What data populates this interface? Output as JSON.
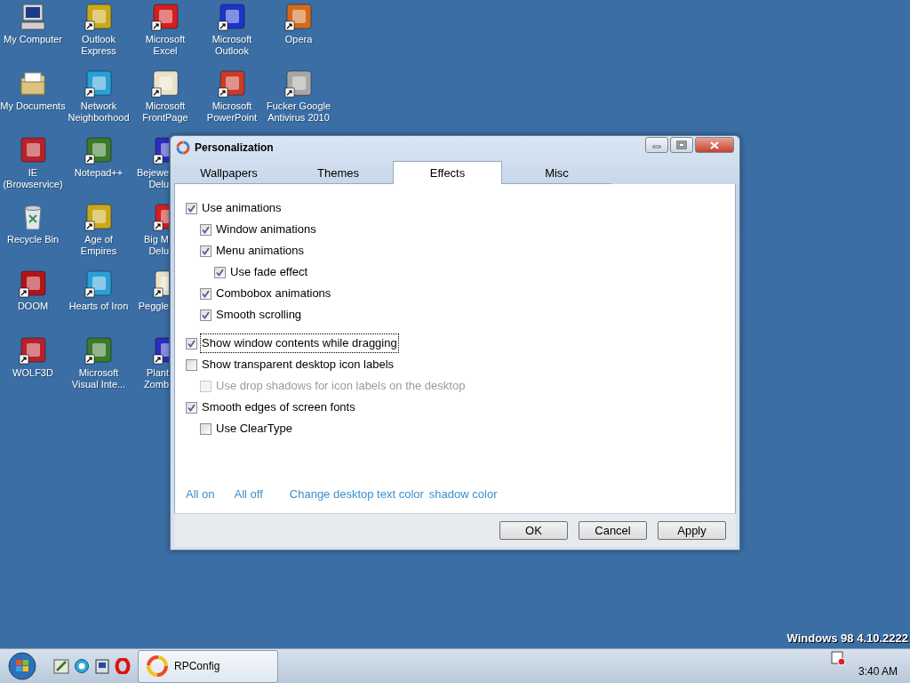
{
  "desktop_rows": [
    [
      {
        "label": [
          "My Computer"
        ]
      },
      {
        "label": [
          "Outlook",
          "Express"
        ]
      },
      {
        "label": [
          "Microsoft",
          "Excel"
        ]
      },
      {
        "label": [
          "Microsoft",
          "Outlook"
        ]
      },
      {
        "label": [
          "Opera"
        ]
      }
    ],
    [
      {
        "label": [
          "My Documents"
        ]
      },
      {
        "label": [
          "Network",
          "Neighborhood"
        ]
      },
      {
        "label": [
          "Microsoft",
          "FrontPage"
        ]
      },
      {
        "label": [
          "Microsoft",
          "PowerPoint"
        ]
      },
      {
        "label": [
          "Fucker Google",
          "Antivirus 2010"
        ]
      }
    ],
    [
      {
        "label": [
          "IE",
          "(Browservice)"
        ]
      },
      {
        "label": [
          "Notepad++"
        ]
      },
      {
        "label": [
          "Bejewe",
          "Delu"
        ]
      }
    ],
    [
      {
        "label": [
          "Recycle Bin"
        ]
      },
      {
        "label": [
          "Age of",
          "Empires"
        ]
      },
      {
        "label": [
          "Big M",
          "Delu"
        ]
      }
    ],
    [
      {
        "label": [
          "DOOM"
        ]
      },
      {
        "label": [
          "Hearts of Iron"
        ]
      },
      {
        "label": [
          "Peggle"
        ]
      }
    ],
    [
      {
        "label": [
          "WOLF3D"
        ]
      },
      {
        "label": [
          "Microsoft",
          "Visual Inte..."
        ]
      },
      {
        "label": [
          "Plant",
          "Zomb"
        ]
      }
    ]
  ],
  "desktop_text": "Windows 98 4.10.2222",
  "window": {
    "title": "Personalization",
    "tabs": [
      {
        "label": "Wallpapers",
        "selected": false
      },
      {
        "label": "Themes",
        "selected": false
      },
      {
        "label": "Effects",
        "selected": true
      },
      {
        "label": "Misc",
        "selected": false
      }
    ],
    "option_groups": [
      [
        {
          "label": "Use animations",
          "checked": true,
          "disabled": false,
          "focused": false,
          "children": [
            {
              "label": "Window animations",
              "checked": true,
              "disabled": false,
              "focused": false
            },
            {
              "label": "Menu animations",
              "checked": true,
              "disabled": false,
              "focused": false,
              "children": [
                {
                  "label": "Use fade effect",
                  "checked": true,
                  "disabled": false,
                  "focused": false
                }
              ]
            },
            {
              "label": "Combobox animations",
              "checked": true,
              "disabled": false,
              "focused": false
            },
            {
              "label": "Smooth scrolling",
              "checked": true,
              "disabled": false,
              "focused": false
            }
          ]
        }
      ],
      [
        {
          "label": "Show window contents while dragging",
          "checked": true,
          "disabled": false,
          "focused": true
        },
        {
          "label": "Show transparent desktop icon labels",
          "checked": false,
          "disabled": false,
          "focused": false,
          "children": [
            {
              "label": "Use drop shadows for icon labels on the desktop",
              "checked": false,
              "disabled": true,
              "focused": false
            }
          ]
        },
        {
          "label": "Smooth edges of screen fonts",
          "checked": true,
          "disabled": false,
          "focused": false,
          "children": [
            {
              "label": "Use ClearType",
              "checked": false,
              "disabled": false,
              "focused": false
            }
          ]
        }
      ]
    ],
    "links": [
      "All on",
      "All off",
      "Change desktop text color",
      "shadow color"
    ],
    "buttons": [
      "OK",
      "Cancel",
      "Apply"
    ]
  },
  "taskbar": {
    "tasks": [
      {
        "label": "RPConfig",
        "selected": true
      }
    ],
    "clock": "3:40 AM"
  }
}
